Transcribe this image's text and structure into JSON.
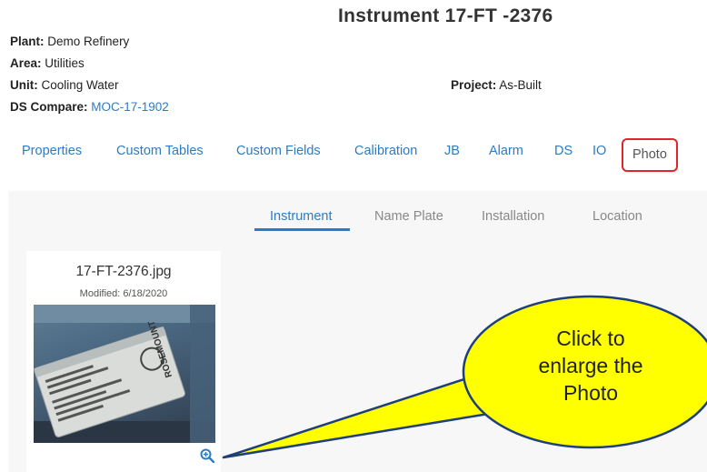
{
  "header": {
    "title": "Instrument 17-FT -2376",
    "plant_label": "Plant:",
    "plant_value": "Demo Refinery",
    "area_label": "Area:",
    "area_value": "Utilities",
    "unit_label": "Unit:",
    "unit_value": "Cooling Water",
    "ds_compare_label": "DS Compare:",
    "ds_compare_value": "MOC-17-1902",
    "project_label": "Project:",
    "project_value": "As-Built"
  },
  "tabs": [
    {
      "label": "Properties"
    },
    {
      "label": "Custom Tables"
    },
    {
      "label": "Custom Fields"
    },
    {
      "label": "Calibration"
    },
    {
      "label": "JB"
    },
    {
      "label": "Alarm"
    },
    {
      "label": "DS"
    },
    {
      "label": "IO"
    },
    {
      "label": "Photo",
      "selected": true
    }
  ],
  "photo_tabs": [
    {
      "label": "Instrument",
      "selected": true
    },
    {
      "label": "Name Plate"
    },
    {
      "label": "Installation"
    },
    {
      "label": "Location"
    }
  ],
  "photo_card": {
    "filename": "17-FT-2376.jpg",
    "modified": "Modified: 6/18/2020",
    "photo_brand_text": "ROSEMOUNT",
    "zoom_icon": "zoom-in-icon"
  },
  "callout": {
    "line1": "Click to",
    "line2": "enlarge the",
    "line3": "Photo"
  },
  "colors": {
    "link": "#2a7cc7",
    "highlight_border": "#e0262c",
    "callout_fill": "#ffff00",
    "callout_border": "#1f3f7a"
  }
}
